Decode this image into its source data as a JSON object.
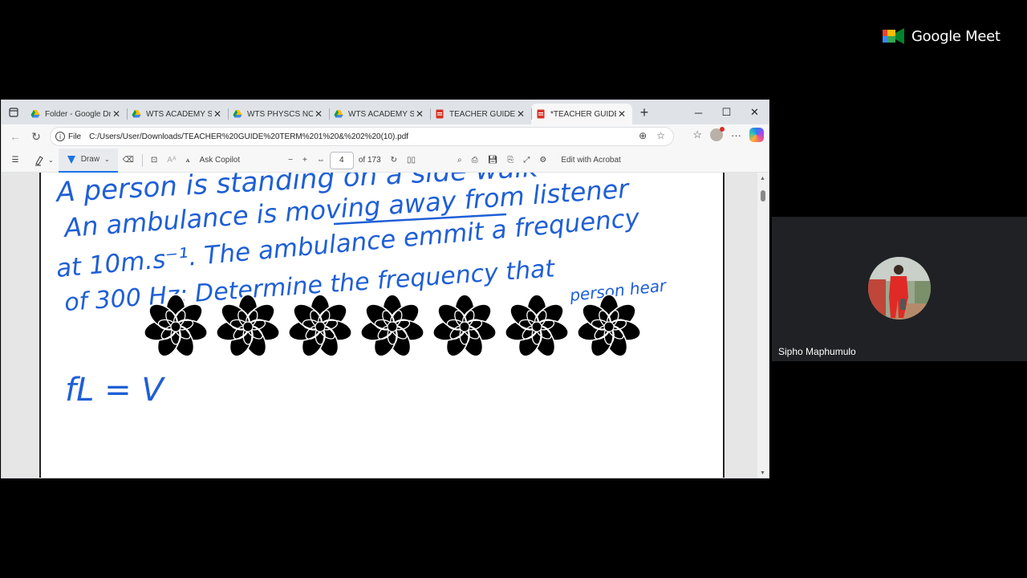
{
  "browser": {
    "tabs": [
      {
        "label": "Folder - Google Dri",
        "icon": "google-drive-icon"
      },
      {
        "label": "WTS ACADEMY STU",
        "icon": "google-drive-icon"
      },
      {
        "label": "WTS PHYSCS NOTE",
        "icon": "google-drive-icon"
      },
      {
        "label": "WTS ACADEMY STU",
        "icon": "google-drive-icon"
      },
      {
        "label": "TEACHER GUIDE TE",
        "icon": "pdf-icon"
      },
      {
        "label": "*TEACHER GUIDE TE",
        "icon": "pdf-icon",
        "active": true
      }
    ],
    "address": {
      "scheme_label": "File",
      "url": "C:/Users/User/Downloads/TEACHER%20GUIDE%20TERM%201%20&%202%20(10).pdf"
    }
  },
  "pdf_toolbar": {
    "draw_label": "Draw",
    "ask_copilot_label": "Ask Copilot",
    "page_current": "4",
    "page_total": "of 173",
    "edit_acrobat_label": "Edit with Acrobat"
  },
  "document": {
    "handwriting": [
      "A person is standing on a side walk",
      "An ambulance is moving away from listener",
      "at 10m.s⁻¹. The ambulance emmit a frequency",
      "of 300 Hz; Determine the frequency that",
      "person hear",
      "fL = V"
    ]
  },
  "meet": {
    "brand": "Google Meet",
    "participant_name": "Sipho Maphumulo"
  },
  "colors": {
    "ink": "#1f5fd6",
    "meet_bg": "#000000",
    "tile_bg": "#202124",
    "draw_accent": "#1a73e8"
  }
}
